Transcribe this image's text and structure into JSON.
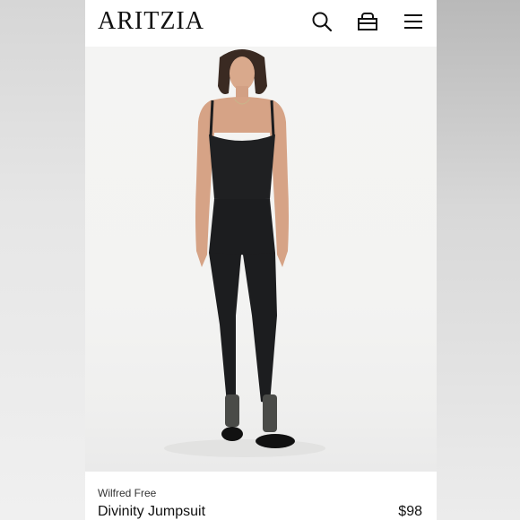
{
  "header": {
    "logo": "ARITZIA",
    "icons": [
      "search-icon",
      "bag-icon",
      "menu-icon"
    ]
  },
  "product": {
    "brand": "Wilfred Free",
    "name": "Divinity Jumpsuit",
    "price": "$98",
    "garment_color": "#1c1d1f"
  }
}
